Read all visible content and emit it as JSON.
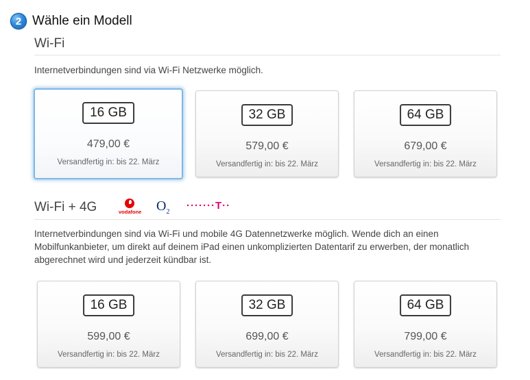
{
  "step": {
    "number": "2",
    "title": "Wähle ein Modell"
  },
  "wifi": {
    "title": "Wi-Fi",
    "description": "Internetverbindungen sind via Wi-Fi Netzwerke möglich.",
    "models": [
      {
        "capacity": "16 GB",
        "price": "479,00 €",
        "shipping": "Versandfertig in: bis 22. März",
        "selected": true
      },
      {
        "capacity": "32 GB",
        "price": "579,00 €",
        "shipping": "Versandfertig in: bis 22. März",
        "selected": false
      },
      {
        "capacity": "64 GB",
        "price": "679,00 €",
        "shipping": "Versandfertig in: bis 22. März",
        "selected": false
      }
    ]
  },
  "cellular": {
    "title": "Wi-Fi + 4G",
    "carriers": {
      "vodafone": "vodafone",
      "o2_main": "O",
      "o2_sub": "2",
      "telekom": "·······T··"
    },
    "description": "Internetverbindungen sind via Wi-Fi und mobile 4G Datennetzwerke möglich. Wende dich an einen Mobilfunkanbieter, um direkt auf deinem iPad einen unkomplizierten Datentarif zu erwerben, der monatlich abgerechnet wird und jederzeit kündbar ist.",
    "models": [
      {
        "capacity": "16 GB",
        "price": "599,00 €",
        "shipping": "Versandfertig in: bis 22. März",
        "selected": false
      },
      {
        "capacity": "32 GB",
        "price": "699,00 €",
        "shipping": "Versandfertig in: bis 22. März",
        "selected": false
      },
      {
        "capacity": "64 GB",
        "price": "799,00 €",
        "shipping": "Versandfertig in: bis 22. März",
        "selected": false
      }
    ]
  },
  "colors": {
    "accent": "#2e88d8",
    "selected_border": "#7fb7e3",
    "vodafone_red": "#e60000",
    "o2_blue": "#0a2d6e",
    "telekom_magenta": "#e20074"
  }
}
